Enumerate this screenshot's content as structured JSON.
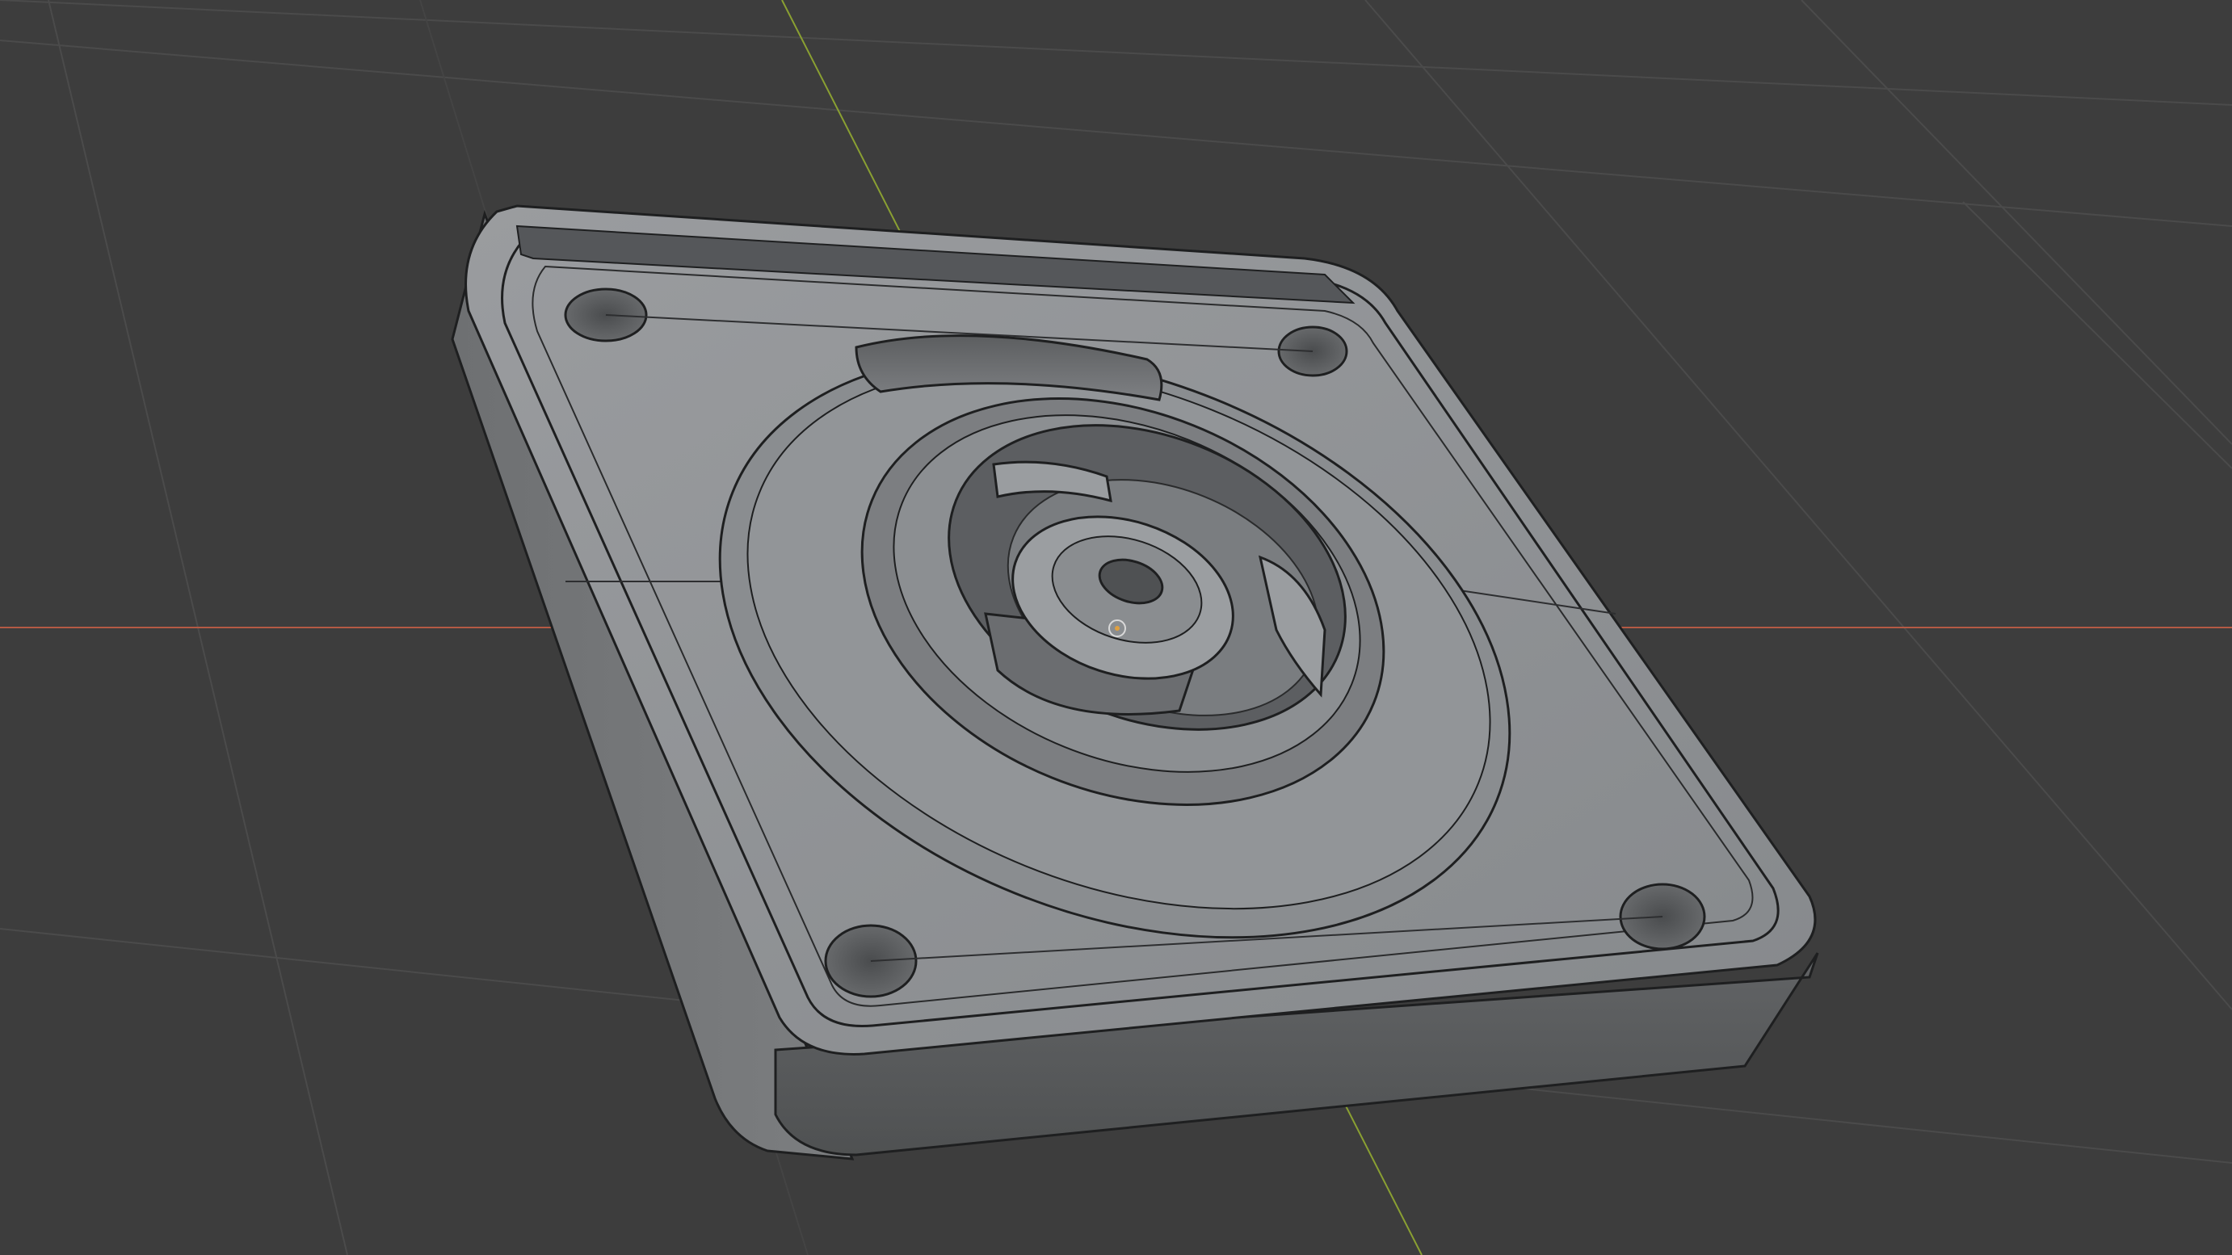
{
  "viewport": {
    "background_color": "#3d3d3d",
    "grid_color": "#4b4b4b",
    "x_axis_color": "#b45a44",
    "y_axis_color": "#8aa032",
    "mesh_fill_color": "#8e9194",
    "mesh_side_color": "#6a6c6e",
    "wire_color": "#1e1f20",
    "origin_icon": "object-origin-icon"
  }
}
